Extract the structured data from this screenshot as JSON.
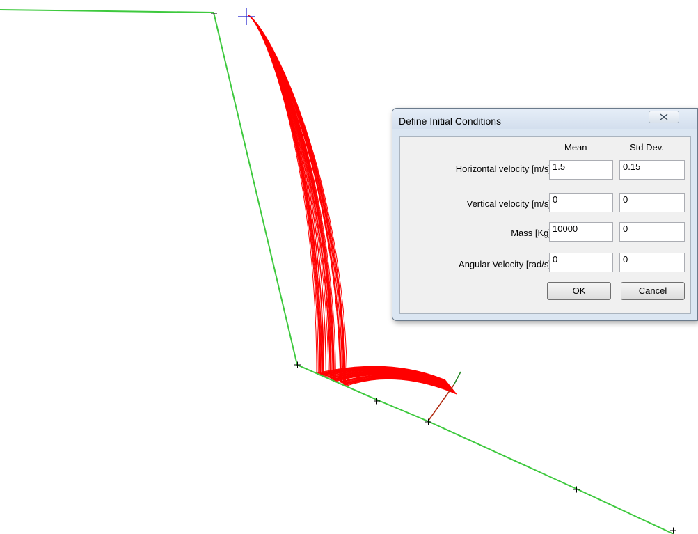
{
  "dialog": {
    "title": "Define Initial Conditions",
    "columns": {
      "mean": "Mean",
      "std_dev": "Std Dev."
    },
    "rows": [
      {
        "label": "Horizontal velocity [m/s]",
        "mean": "1.5",
        "std_dev": "0.15"
      },
      {
        "label": "Vertical velocity [m/s]",
        "mean": "0",
        "std_dev": "0"
      },
      {
        "label": "Mass [Kg]",
        "mean": "10000",
        "std_dev": "0"
      },
      {
        "label": "Angular Velocity [rad/s]",
        "mean": "0",
        "std_dev": "0"
      }
    ],
    "ok_label": "OK",
    "cancel_label": "Cancel"
  },
  "colors": {
    "slope": "#3ec93e",
    "trajectories": "#ff0000",
    "seeder": "#1a1acc",
    "barrier": "#b02a10",
    "barrier_top": "#2a8a2a",
    "vertex_marker": "#000000"
  }
}
